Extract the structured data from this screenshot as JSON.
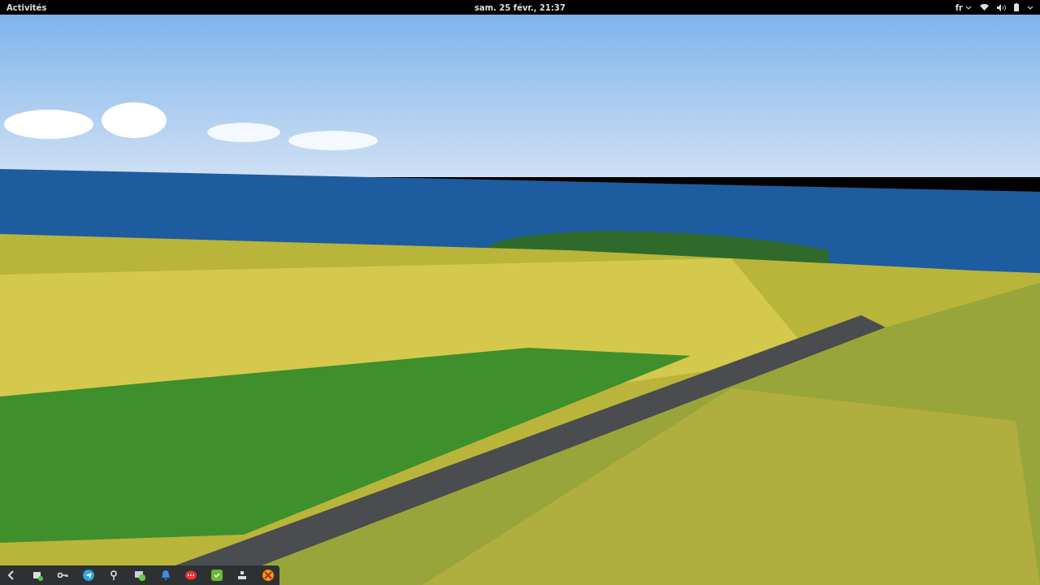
{
  "top_bar": {
    "activities": "Activités",
    "clock": "sam. 25 févr., 21:37",
    "language": "fr"
  }
}
